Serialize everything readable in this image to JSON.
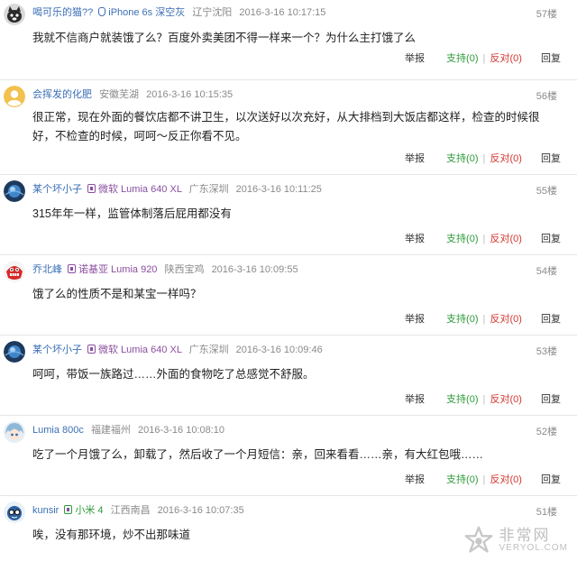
{
  "labels": {
    "report": "举报",
    "support": "支持",
    "oppose": "反对",
    "reply": "回复",
    "open_paren": "(",
    "close_paren": ")"
  },
  "comments": [
    {
      "username": "喝可乐的猫??",
      "avatar_icon": "cat-avatar-icon",
      "device_icon": "apple-icon",
      "device": "iPhone 6s",
      "device_color": "深空灰",
      "location": "辽宁沈阳",
      "time": "2016-3-16 10:17:15",
      "floor": "57楼",
      "text": "我就不信商户就装饿了么？百度外卖美团不得一样来一个？为什么主打饿了么",
      "support_count": "0",
      "oppose_count": "0"
    },
    {
      "username": "会挥发的化肥",
      "avatar_icon": "default-user-avatar-icon",
      "device_icon": "",
      "device": "",
      "device_color": "",
      "location": "安徽芜湖",
      "time": "2016-3-16 10:15:35",
      "floor": "56楼",
      "text": "很正常，现在外面的餐饮店都不讲卫生，以次送好以次充好，从大排档到大饭店都这样，检查的时候很好，不检查的时候，呵呵～反正你看不见。",
      "support_count": "0",
      "oppose_count": "0"
    },
    {
      "username": "某个坏小子",
      "avatar_icon": "blue-orb-avatar-icon",
      "device_icon": "phone-icon",
      "device": "微软 Lumia 640 XL",
      "device_color": "",
      "location": "广东深圳",
      "time": "2016-3-16 10:11:25",
      "floor": "55楼",
      "text": "315年年一样，监管体制落后屁用都没有",
      "support_count": "0",
      "oppose_count": "0"
    },
    {
      "username": "乔北峰",
      "avatar_icon": "red-monster-avatar-icon",
      "device_icon": "phone-icon",
      "device": "诺基亚 Lumia 920",
      "device_color": "",
      "location": "陕西宝鸡",
      "time": "2016-3-16 10:09:55",
      "floor": "54楼",
      "text": "饿了么的性质不是和某宝一样吗？",
      "support_count": "0",
      "oppose_count": "0"
    },
    {
      "username": "某个坏小子",
      "avatar_icon": "blue-orb-avatar-icon",
      "device_icon": "phone-icon",
      "device": "微软 Lumia 640 XL",
      "device_color": "",
      "location": "广东深圳",
      "time": "2016-3-16 10:09:46",
      "floor": "53楼",
      "text": "呵呵，带饭一族路过……外面的食物吃了总感觉不舒服。",
      "support_count": "0",
      "oppose_count": "0"
    },
    {
      "username": "Lumia 800c",
      "avatar_icon": "anime-avatar-icon",
      "device_icon": "",
      "device": "",
      "device_color": "",
      "location": "福建福州",
      "time": "2016-3-16 10:08:10",
      "floor": "52楼",
      "text": "吃了一个月饿了么，卸载了，然后收了一个月短信：亲，回来看看……亲，有大红包哦……",
      "support_count": "0",
      "oppose_count": "0"
    },
    {
      "username": "kunsir",
      "avatar_icon": "glasses-avatar-icon",
      "device_icon": "phone-icon",
      "device": "小米 4",
      "device_color": "",
      "location": "江西南昌",
      "time": "2016-3-16 10:07:35",
      "floor": "51楼",
      "text": "唉，没有那环境，炒不出那味道",
      "support_count": "",
      "oppose_count": ""
    }
  ],
  "watermark": {
    "cn": "非常网",
    "en": "VERYOL.COM"
  },
  "colors": {
    "username": "#3b6fb5",
    "device": "#8a4fa0",
    "support": "#2e9a3a",
    "oppose": "#d4362f"
  }
}
